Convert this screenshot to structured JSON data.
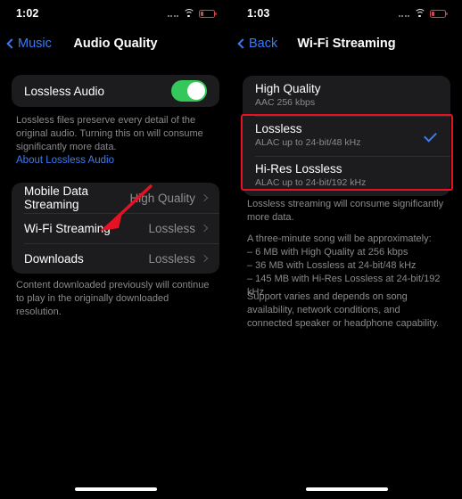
{
  "left": {
    "status": {
      "time": "1:02",
      "wifi_icon": "wifi-icon",
      "battery_icon": "battery-low-icon",
      "signal_icon": "signal-dots-icon"
    },
    "nav": {
      "back_label": "Music",
      "title": "Audio Quality"
    },
    "toggle_row": {
      "label": "Lossless Audio",
      "state": "on"
    },
    "note1": "Lossless files preserve every detail of the original audio. Turning this on will consume significantly more data.",
    "link": "About Lossless Audio",
    "rows": [
      {
        "label": "Mobile Data Streaming",
        "value": "High Quality"
      },
      {
        "label": "Wi-Fi Streaming",
        "value": "Lossless"
      },
      {
        "label": "Downloads",
        "value": "Lossless"
      }
    ],
    "note2": "Content downloaded previously will continue to play in the originally downloaded resolution."
  },
  "right": {
    "status": {
      "time": "1:03",
      "wifi_icon": "wifi-icon",
      "battery_icon": "battery-low-icon",
      "signal_icon": "signal-dots-icon"
    },
    "nav": {
      "back_label": "Back",
      "title": "Wi-Fi Streaming"
    },
    "options": [
      {
        "title": "High Quality",
        "sub": "AAC 256 kbps",
        "selected": false
      },
      {
        "title": "Lossless",
        "sub": "ALAC up to 24-bit/48 kHz",
        "selected": true
      },
      {
        "title": "Hi-Res Lossless",
        "sub": "ALAC up to 24-bit/192 kHz",
        "selected": false
      }
    ],
    "note1": "Lossless streaming will consume significantly more data.",
    "note2_head": "A three-minute song will be approximately:",
    "note2_items": [
      "– 6 MB with High Quality at 256 kbps",
      "– 36 MB with Lossless at 24-bit/48 kHz",
      "– 145 MB with Hi-Res Lossless at 24-bit/192 kHz"
    ],
    "note3": "Support varies and depends on song availability, network conditions, and connected speaker or headphone capability."
  },
  "annotations": {
    "arrow_color": "#e81123",
    "box_color": "#e81123"
  }
}
